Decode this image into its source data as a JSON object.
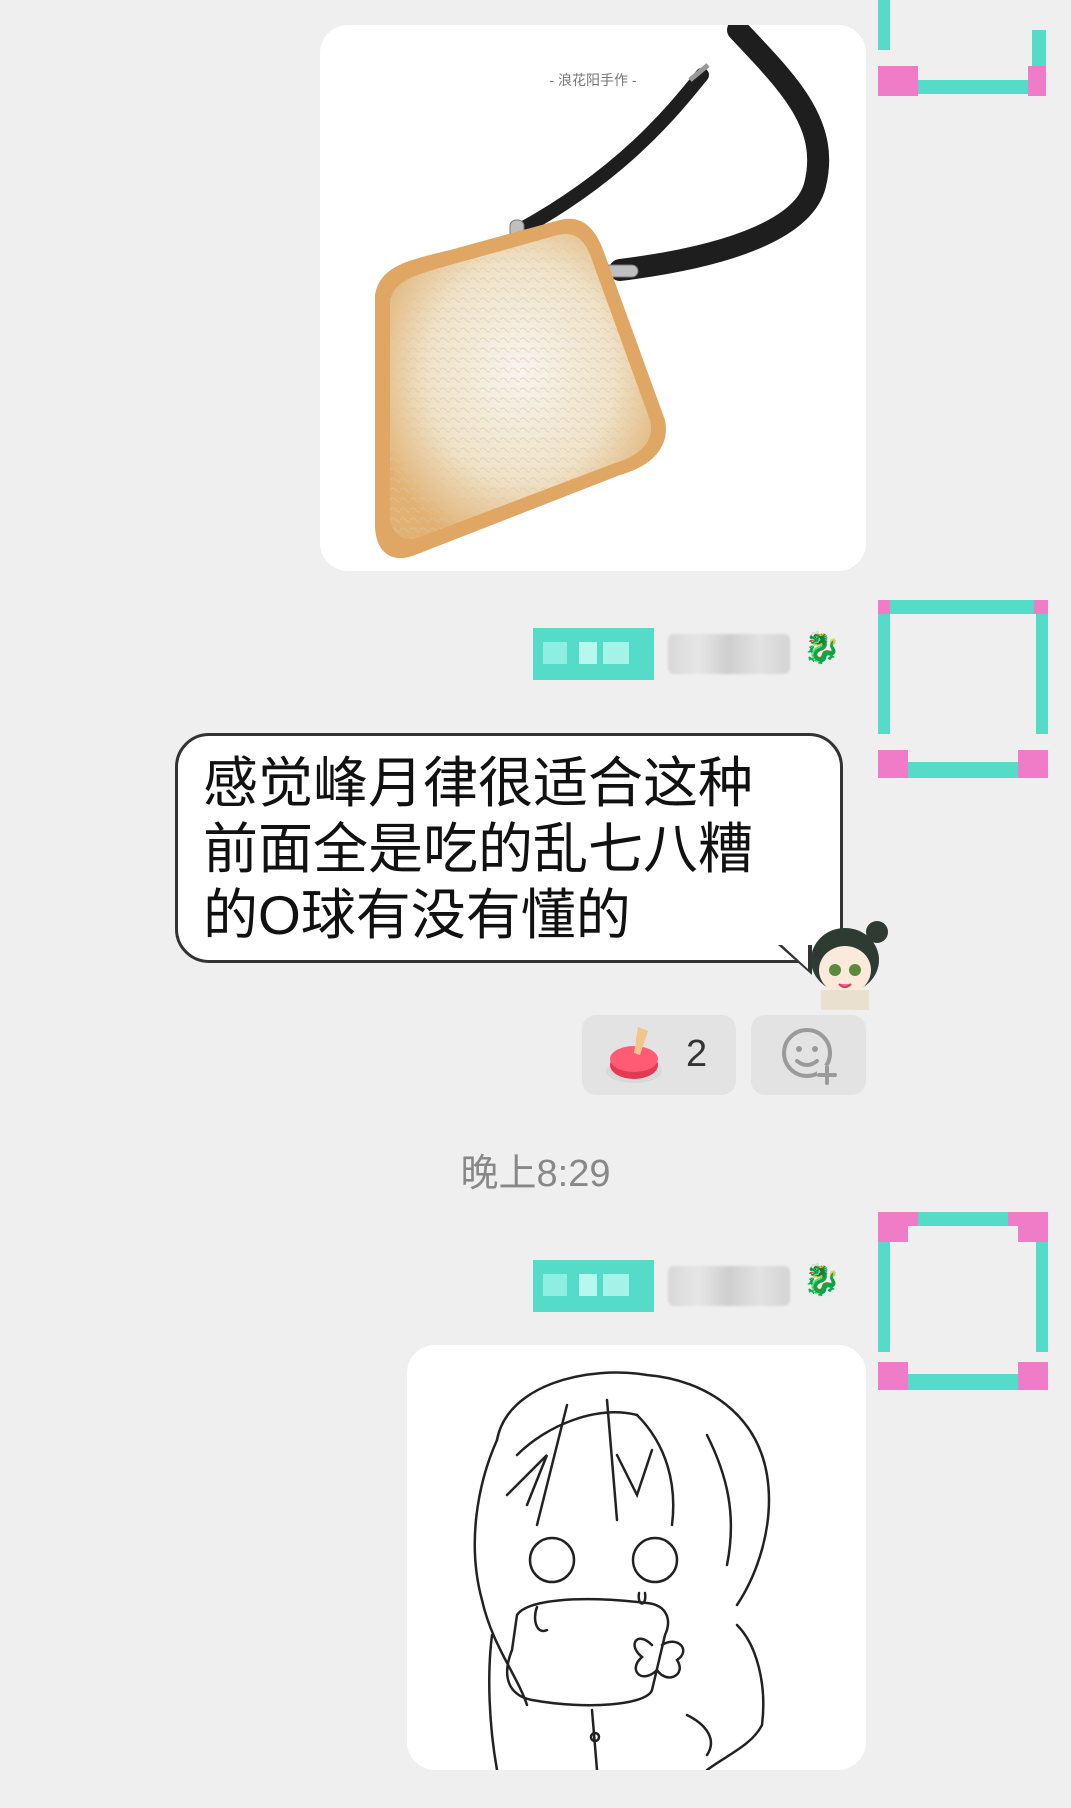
{
  "messages": {
    "image1": {
      "watermark": "- 浪花阳手作 -",
      "subject": "toast-bag"
    },
    "text_message": {
      "sender_emoji": "🐉",
      "text": "感觉峰月律很适合这种前面全是吃的乱七八糟的O球有没有懂的",
      "reactions": [
        {
          "icon": "red-button-icon",
          "count": "2"
        }
      ]
    },
    "timestamp": "晚上8:29",
    "image2": {
      "sender_emoji": "🐉",
      "subject": "sketch-girl-with-toast"
    }
  },
  "colors": {
    "background": "#efefef",
    "accent_teal": "#55dcc8",
    "accent_pink": "#f07bc6"
  }
}
